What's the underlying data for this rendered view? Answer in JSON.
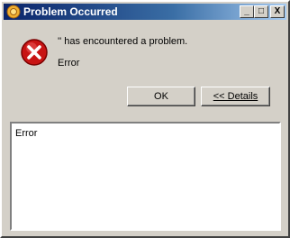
{
  "window": {
    "title": "Problem Occurred",
    "controls": {
      "minimize": "_",
      "maximize": "□",
      "close": "X"
    }
  },
  "icons": {
    "title_icon": "app-icon",
    "error_icon": "error-icon"
  },
  "message": {
    "text": "'' has encountered a problem.",
    "sub_text": "Error"
  },
  "buttons": {
    "ok": "OK",
    "details": "<< Details"
  },
  "details": {
    "text": "Error"
  },
  "colors": {
    "title_start": "#0a246a",
    "title_end": "#a6caf0",
    "dialog_bg": "#d4d0c8",
    "error_red": "#c81414"
  }
}
